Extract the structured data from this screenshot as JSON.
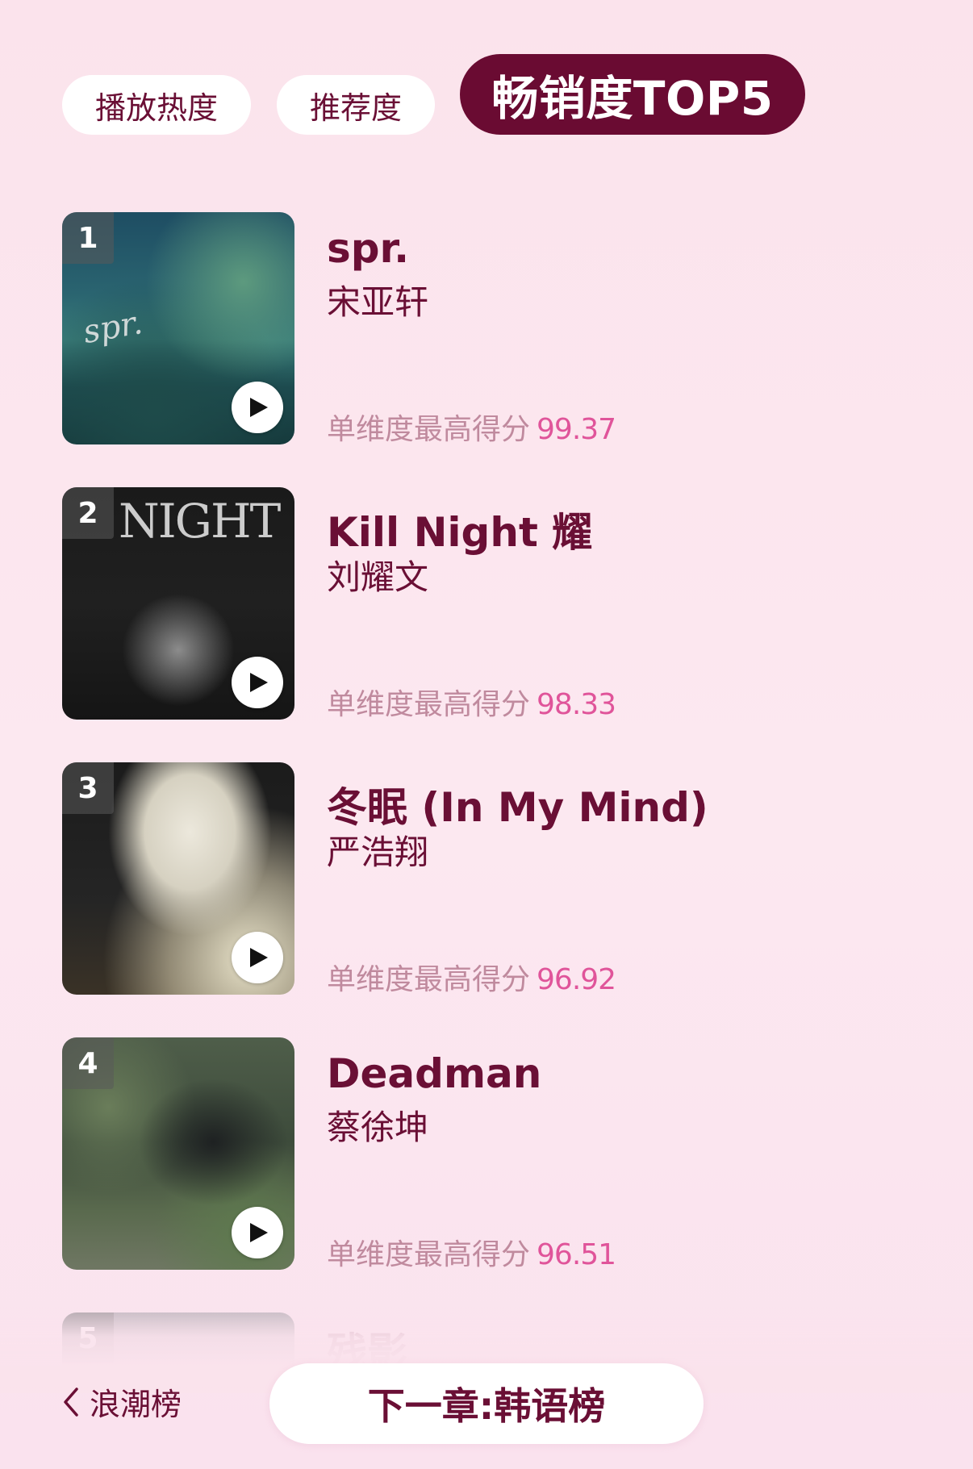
{
  "tabs": [
    {
      "label": "播放热度",
      "active": false
    },
    {
      "label": "推荐度",
      "active": false
    },
    {
      "label": "畅销度TOP5",
      "active": true
    }
  ],
  "colors": {
    "accent": "#6a0b32",
    "title_text": "#6a0f35",
    "score_label": "#c08a9e",
    "score_value": "#e0549a",
    "background": "#fce8f0"
  },
  "score_label": "单维度最高得分",
  "items": [
    {
      "rank": "1",
      "title": "spr.",
      "artist": "宋亚轩",
      "score": "99.37",
      "cover_text": "spr."
    },
    {
      "rank": "2",
      "title": "Kill Night 耀",
      "artist": "刘耀文",
      "score": "98.33",
      "cover_text": "NIGHT"
    },
    {
      "rank": "3",
      "title": "冬眠 (In My Mind)",
      "artist": "严浩翔",
      "score": "96.92"
    },
    {
      "rank": "4",
      "title": "Deadman",
      "artist": "蔡徐坤",
      "score": "96.51"
    },
    {
      "rank": "5",
      "title": "残影"
    }
  ],
  "footer": {
    "back_label": "浪潮榜",
    "next_label": "下一章:韩语榜"
  },
  "icons": {
    "play": "play-icon",
    "back": "chevron-left-icon"
  }
}
